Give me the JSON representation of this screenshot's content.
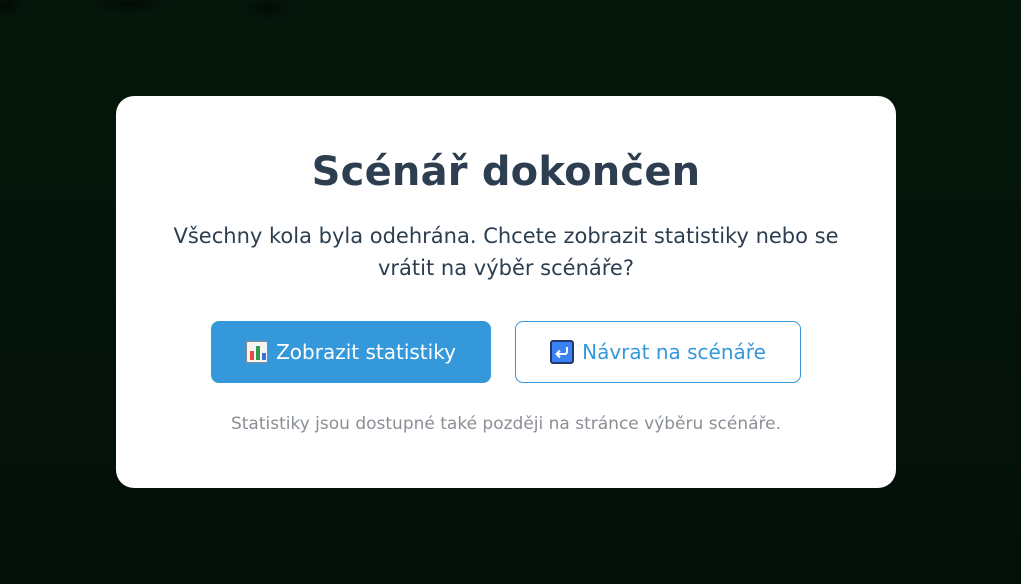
{
  "dialog": {
    "title": "Scénář dokončen",
    "message": "Všechny kola byla odehrána. Chcete zobrazit statistiky nebo se vrátit na výběr scénáře?",
    "buttons": {
      "show_stats": {
        "label": "Zobrazit statistiky",
        "icon": "bar-chart-icon",
        "color": "#3498db"
      },
      "back_to_scenarios": {
        "label": "Návrat na scénáře",
        "icon": "return-arrow-icon",
        "color": "#3498db"
      }
    },
    "note": "Statistiky jsou dostupné také později na stránce výběru scénáře."
  },
  "colors": {
    "backdrop": "#041208",
    "dialog_bg": "#ffffff",
    "title_text": "#2c3e50",
    "accent": "#3498db",
    "note_text": "#8a8f96"
  }
}
